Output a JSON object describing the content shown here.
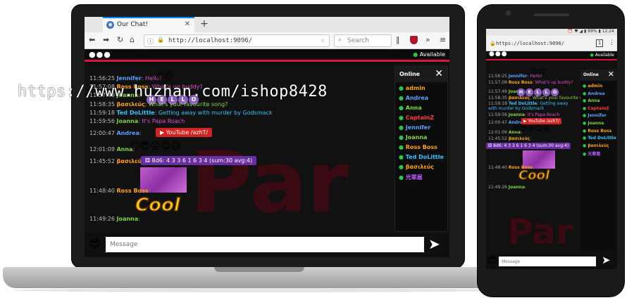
{
  "browser": {
    "tab_title": "Our Chat!",
    "url": "http://localhost:9096/",
    "search_placeholder": "Search"
  },
  "app": {
    "menu_dots": "●●●",
    "status": "Available",
    "watermark": "Par",
    "online_title": "Online",
    "close_glyph": "✕",
    "input_placeholder": "Message",
    "send_glyph": "➤"
  },
  "messages": [
    {
      "time": "11:56:25",
      "name": "Jennifer",
      "name_color": "#5aa0ff",
      "text": "Hello!",
      "text_color": "#e04bd0"
    },
    {
      "time": "11:57:08",
      "name": "Ross Boss",
      "name_color": "#ffa31a",
      "text": "What's up buddy?",
      "text_color": "#e04bd0"
    },
    {
      "time": "11:57:49",
      "name": "Joanna",
      "name_color": "#7fd43a",
      "text": "",
      "text_color": "#aaa"
    },
    {
      "time": "11:58:35",
      "name": "βασιλεύς",
      "name_color": "#ffa31a",
      "text": "What's your favourite song?",
      "text_color": "#8fd34a"
    },
    {
      "time": "11:59:18",
      "name": "Ted DoLittle",
      "name_color": "#34c4ff",
      "text": "Getting away with murder by Godsmack",
      "text_color": "#34c4ff"
    },
    {
      "time": "11:59:56",
      "name": "Joanna",
      "name_color": "#7fd43a",
      "text": "It's Papa Roach",
      "text_color": "#e04bd0"
    },
    {
      "time": "12:00:47",
      "name": "Andrea",
      "name_color": "#5aa0ff",
      "text": "",
      "text_color": "#aaa"
    },
    {
      "time": "12:01:09",
      "name": "Anna",
      "name_color": "#7fd43a",
      "text": "",
      "text_color": "#aaa"
    },
    {
      "time": "11:45:52",
      "name": "βασιλεύς",
      "name_color": "#ffa31a",
      "text": "",
      "text_color": "#aaa"
    },
    {
      "time": "11:48:40",
      "name": "Ross Boss",
      "name_color": "#ffa31a",
      "text": "",
      "text_color": "#aaa"
    },
    {
      "time": "11:49:26",
      "name": "Joanna",
      "name_color": "#7fd43a",
      "text": "",
      "text_color": "#aaa"
    }
  ],
  "youtube_label": "YouTube /azhT/",
  "youtube_label_phone": "YouTube /azhT/",
  "dice_text": "8d6: 4 3 3 6 1 6 3 4 (sum:30 avg:4)",
  "hello_letters": [
    "H",
    "E",
    "L",
    "L",
    "O"
  ],
  "cool_text": "Cool",
  "emoji_row_andrea": [
    "😉",
    "😎",
    "😜",
    "😋",
    "😆"
  ],
  "emoji_hello": "😍😍",
  "online_users": [
    {
      "name": "admin",
      "color": "#ffa31a"
    },
    {
      "name": "Andrea",
      "color": "#5aa0ff"
    },
    {
      "name": "Anna",
      "color": "#7fd43a"
    },
    {
      "name": "CaptainZ",
      "color": "#ff3b3b"
    },
    {
      "name": "Jennifer",
      "color": "#5aa0ff"
    },
    {
      "name": "Joanna",
      "color": "#7fd43a"
    },
    {
      "name": "Ross Boss",
      "color": "#ffa31a"
    },
    {
      "name": "Ted DoLittle",
      "color": "#34c4ff"
    },
    {
      "name": "βασιλεύς",
      "color": "#ffa31a"
    },
    {
      "name": "光辈扈",
      "color": "#b45cff"
    }
  ],
  "phone": {
    "status_bar": "⏰ ♥ ◢ ▮ 89% ▮ 12:24",
    "url": "https://localhost:9096/",
    "tab_count": "1",
    "menu": "⋮",
    "status": "Available"
  },
  "overlay_text": "https://www.huzhan.com/ishop8428"
}
